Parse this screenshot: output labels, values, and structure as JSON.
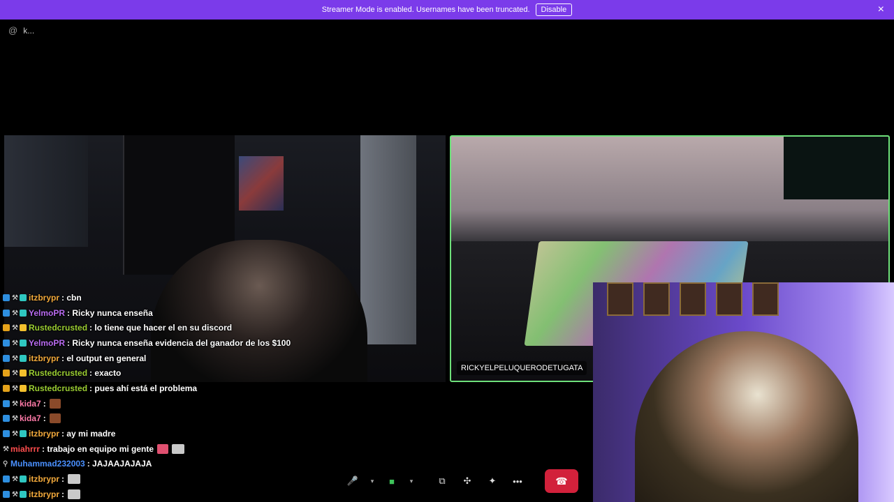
{
  "banner": {
    "message": "Streamer Mode is enabled. Usernames have been truncated.",
    "disable_label": "Disable",
    "close_glyph": "×"
  },
  "channel": {
    "icon": "@",
    "name": "k..."
  },
  "tiles": {
    "remote_name": "RICKYELPELUQUERODETUGATA"
  },
  "chat": {
    "messages": [
      {
        "user": "itzbrypr",
        "color": "#f2a93b",
        "text": " : cbn"
      },
      {
        "user": "YelmoPR",
        "color": "#b86bf0",
        "text": " : Ricky nunca enseña"
      },
      {
        "user": "Rustedcrusted",
        "color": "#9acd32",
        "text": " : lo tiene que hacer el en su discord"
      },
      {
        "user": "YelmoPR",
        "color": "#b86bf0",
        "text": " : Ricky nunca enseña evidencia del ganador de los $100"
      },
      {
        "user": "itzbrypr",
        "color": "#f2a93b",
        "text": " : el output en general"
      },
      {
        "user": "Rustedcrusted",
        "color": "#9acd32",
        "text": " : exacto"
      },
      {
        "user": "Rustedcrusted",
        "color": "#9acd32",
        "text": " : pues ahí está el problema"
      },
      {
        "user": "kida7",
        "color": "#ff7aa8",
        "text": " :"
      },
      {
        "user": "kida7",
        "color": "#ff7aa8",
        "text": " :"
      },
      {
        "user": "itzbrypr",
        "color": "#f2a93b",
        "text": " : ay mi madre"
      },
      {
        "user": "miahrrr",
        "color": "#ff4d4d",
        "text": " : trabajo en equipo mi gente"
      },
      {
        "user": "Muhammad232003",
        "color": "#4a90ff",
        "text": " : JAJAAJAJAJA"
      },
      {
        "user": "itzbrypr",
        "color": "#f2a93b",
        "text": " :"
      },
      {
        "user": "itzbrypr",
        "color": "#f2a93b",
        "text": " :"
      }
    ]
  },
  "controls": {
    "mic_icon": "🎤",
    "mic_options": "▾",
    "camera_icon": "■",
    "camera_options": "▾",
    "screenshare_icon": "⧉",
    "activities_icon": "✣",
    "soundboard_icon": "✦",
    "more_icon": "•••",
    "end_icon": "☎"
  },
  "colors": {
    "banner": "#7b3bea",
    "end_call": "#d2213b",
    "speaking_border": "#6ee07a"
  }
}
